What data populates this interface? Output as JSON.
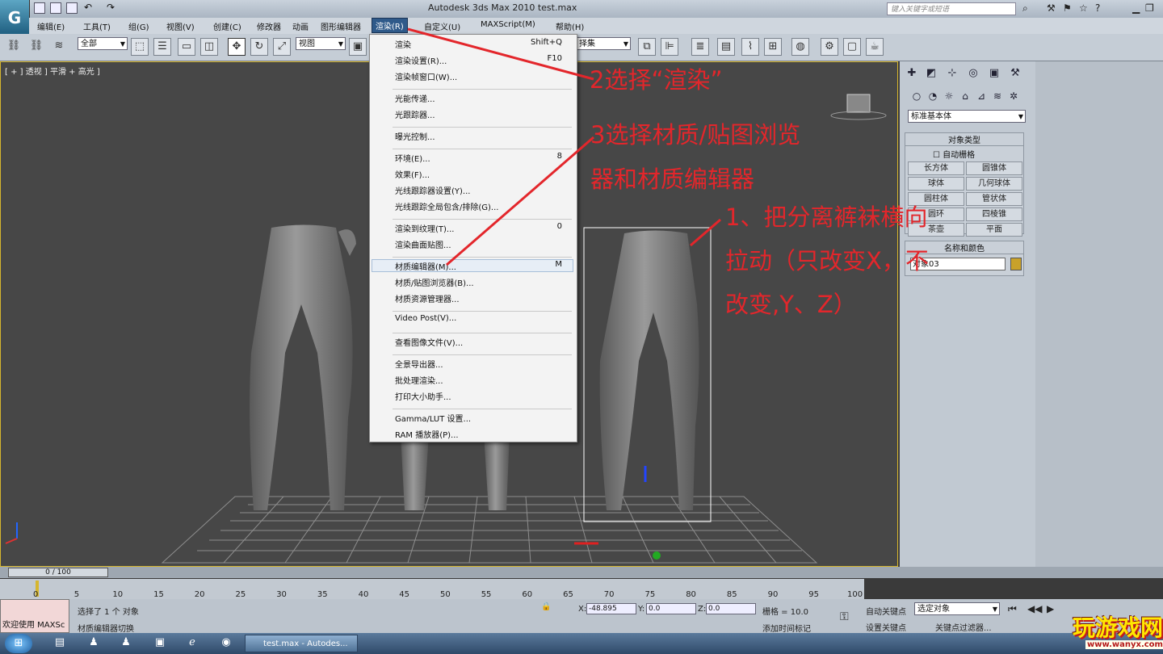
{
  "window": {
    "title": "Autodesk 3ds Max  2010        test.max",
    "search_placeholder": "键入关键字或短语"
  },
  "menubar": [
    "编辑(E)",
    "工具(T)",
    "组(G)",
    "视图(V)",
    "创建(C)",
    "修改器",
    "动画",
    "图形编辑器",
    "渲染(R)",
    "自定义(U)",
    "MAXScript(M)",
    "帮助(H)"
  ],
  "toolbar": {
    "filter_value": "全部",
    "coord_value": "视图",
    "selection_set_value": "择集"
  },
  "viewport": {
    "label": "[ + ] 透视 ] 平滑 + 高光 ]"
  },
  "render_menu": {
    "groups": [
      [
        {
          "label": "渲染",
          "shortcut": "Shift+Q"
        },
        {
          "label": "渲染设置(R)...",
          "shortcut": "F10"
        },
        {
          "label": "渲染帧窗口(W)...",
          "shortcut": ""
        }
      ],
      [
        {
          "label": "光能传递...",
          "shortcut": ""
        },
        {
          "label": "光跟踪器...",
          "shortcut": ""
        }
      ],
      [
        {
          "label": "曝光控制...",
          "shortcut": ""
        }
      ],
      [
        {
          "label": "环境(E)...",
          "shortcut": "8"
        },
        {
          "label": "效果(F)...",
          "shortcut": ""
        },
        {
          "label": "光线跟踪器设置(Y)...",
          "shortcut": ""
        },
        {
          "label": "光线跟踪全局包含/排除(G)...",
          "shortcut": ""
        }
      ],
      [
        {
          "label": "渲染到纹理(T)...",
          "shortcut": "0"
        },
        {
          "label": "渲染曲面贴图...",
          "shortcut": ""
        }
      ],
      [
        {
          "label": "材质编辑器(M)...",
          "shortcut": "M"
        },
        {
          "label": "材质/贴图浏览器(B)...",
          "shortcut": ""
        },
        {
          "label": "材质资源管理器...",
          "shortcut": ""
        }
      ],
      [
        {
          "label": "Video Post(V)...",
          "shortcut": ""
        }
      ],
      [
        {
          "label": "查看图像文件(V)...",
          "shortcut": ""
        }
      ],
      [
        {
          "label": "全景导出器...",
          "shortcut": ""
        },
        {
          "label": "批处理渲染...",
          "shortcut": ""
        },
        {
          "label": "打印大小助手...",
          "shortcut": ""
        }
      ],
      [
        {
          "label": "Gamma/LUT 设置...",
          "shortcut": ""
        },
        {
          "label": "RAM 播放器(P)...",
          "shortcut": ""
        }
      ]
    ]
  },
  "command_panel": {
    "category_dropdown": "标准基本体",
    "object_type_title": "对象类型",
    "autogrid_label": "自动栅格",
    "object_buttons": [
      "长方体",
      "圆锥体",
      "球体",
      "几何球体",
      "圆柱体",
      "管状体",
      "圆环",
      "四棱锥",
      "茶壶",
      "平面"
    ],
    "name_color_title": "名称和颜色",
    "object_name": "对象03",
    "object_color": "#c8a12a"
  },
  "timeline": {
    "slider": "0 / 100",
    "ticks": [
      "0",
      "5",
      "10",
      "15",
      "20",
      "25",
      "30",
      "35",
      "40",
      "45",
      "50",
      "55",
      "60",
      "65",
      "70",
      "75",
      "80",
      "85",
      "90",
      "95",
      "100"
    ]
  },
  "status": {
    "maxscript": "欢迎使用 MAXSc",
    "selection": "选择了 1 个 对象",
    "prompt": "材质编辑器切换",
    "x_label": "X:",
    "x_value": "-48.895",
    "y_label": "Y:",
    "y_value": "0.0",
    "z_label": "Z:",
    "z_value": "0.0",
    "grid": "栅格 = 10.0",
    "add_time_tag": "添加时间标记",
    "auto_key": "自动关键点",
    "auto_key_dropdown": "选定对象",
    "set_key": "设置关键点",
    "key_filters": "关键点过滤器..."
  },
  "taskbar": {
    "active_task": "test.max - Autodes..."
  },
  "annotations": {
    "step2": "2选择“渲染”",
    "step3_line1": "3选择材质/贴图浏览",
    "step3_line2": "器和材质编辑器",
    "step1_line1": "1、把分离裤袜横向",
    "step1_line2": "拉动（只改变X，不",
    "step1_line3": "改变,Y、Z）"
  },
  "watermark": {
    "text": "玩游戏网",
    "url": "www.wanyx.com"
  },
  "colors": {
    "highlight": "#2f5a8a",
    "annotation": "#e3262b",
    "viewport_border": "#d6b62e"
  }
}
